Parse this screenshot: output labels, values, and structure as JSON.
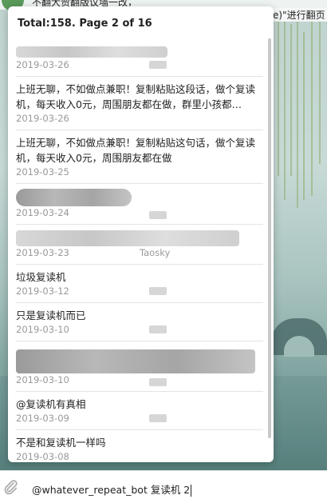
{
  "chat": {
    "top_left_text": "不翻大赞翻版议墙一改，",
    "top_right_text": "e)\"进行翻页"
  },
  "popup": {
    "header": "Total:158. Page 2 of 16",
    "items": [
      {
        "text": "",
        "date": "2019-03-26",
        "name": ""
      },
      {
        "text": "上班无聊，不如做点兼职！复制粘贴这段话，做个复读机，每天收入0元，周围朋友都在做，群里小孩都…",
        "date": "2019-03-26",
        "name": ""
      },
      {
        "text": "上班无聊，不如做点兼职！复制粘贴这句话，做个复读机，每天收入0元，周围朋友都在做",
        "date": "2019-03-25",
        "name": ""
      },
      {
        "text": "",
        "date": "2019-03-24",
        "name": ""
      },
      {
        "text": "",
        "date": "2019-03-23",
        "name": "Taosky"
      },
      {
        "text": "垃圾复读机",
        "date": "2019-03-12",
        "name": ""
      },
      {
        "text": "只是复读机而已",
        "date": "2019-03-10",
        "name": ""
      },
      {
        "text": "",
        "date": "2019-03-10",
        "name": ""
      },
      {
        "text": "@复读机有真相",
        "date": "2019-03-09",
        "name": ""
      },
      {
        "text": "不是和复读机一样吗",
        "date": "2019-03-08",
        "name": ""
      }
    ]
  },
  "input": {
    "value": "@whatever_repeat_bot 复读机 2"
  },
  "icons": {
    "attach": "paperclip-icon"
  }
}
